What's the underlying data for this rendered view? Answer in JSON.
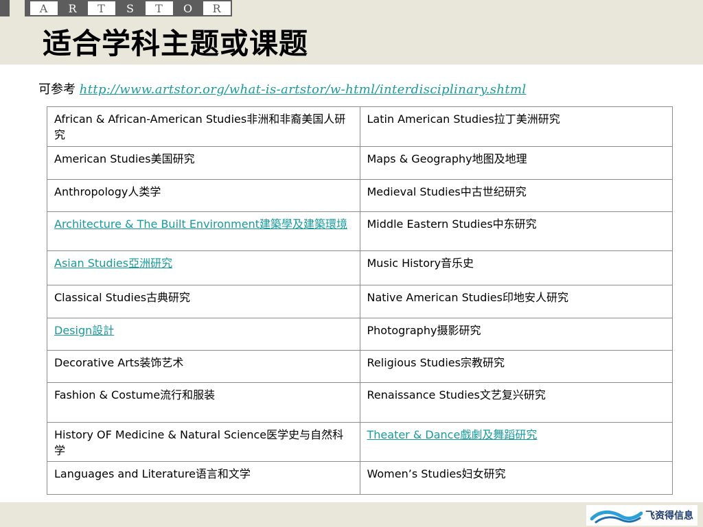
{
  "logo": {
    "letters": [
      "A",
      "R",
      "T",
      "S",
      "T",
      "O",
      "R"
    ]
  },
  "slide": {
    "title": "适合学科主题或课题",
    "reference_label": "可参考",
    "reference_url": "http://www.artstor.org/what-is-artstor/w-html/interdisciplinary.shtml"
  },
  "rows": [
    [
      {
        "text": "African & African-American Studies非洲和非裔美国人研究",
        "link": false
      },
      {
        "text": "Latin American Studies拉丁美洲研究",
        "link": false
      }
    ],
    [
      {
        "text": "American Studies美国研究",
        "link": false
      },
      {
        "text": "Maps & Geography地图及地理",
        "link": false
      }
    ],
    [
      {
        "text": "Anthropology人类学",
        "link": false
      },
      {
        "text": "Medieval Studies中古世纪研究",
        "link": false
      }
    ],
    [
      {
        "text": "Architecture & The Built Environment建築學及建築環境",
        "link": true
      },
      {
        "text": "Middle Eastern Studies中东研究",
        "link": false
      }
    ],
    [
      {
        "text": "Asian Studies亞洲研究",
        "link": true
      },
      {
        "text": "Music History音乐史",
        "link": false
      }
    ],
    [
      {
        "text": "Classical Studies古典研究",
        "link": false
      },
      {
        "text": "Native American Studies印地安人研究",
        "link": false
      }
    ],
    [
      {
        "text": "Design設計",
        "link": true
      },
      {
        "text": "Photography摄影研究",
        "link": false
      }
    ],
    [
      {
        "text": "Decorative Arts装饰艺术",
        "link": false
      },
      {
        "text": "Religious Studies宗教研究",
        "link": false
      }
    ],
    [
      {
        "text": "Fashion & Costume流行和服装",
        "link": false
      },
      {
        "text": "Renaissance Studies文艺复兴研究",
        "link": false
      }
    ],
    [
      {
        "text": "History OF Medicine & Natural Science医学史与自然科学",
        "link": false
      },
      {
        "text": "Theater & Dance戲劇及舞蹈研究",
        "link": true
      }
    ],
    [
      {
        "text": "Languages and Literature语言和文学",
        "link": false
      },
      {
        "text": "Women’s Studies妇女研究",
        "link": false
      }
    ]
  ],
  "row_heights": [
    58,
    48,
    47,
    57,
    50,
    48,
    47,
    47,
    58,
    57,
    48
  ],
  "company": {
    "name": "飞资得信息",
    "brand_color": "#1c3b6e",
    "accent_color": "#2b9fd8"
  },
  "colors": {
    "band": "#e8e7da",
    "link": "#169b9b",
    "border": "#8c8c8c"
  }
}
